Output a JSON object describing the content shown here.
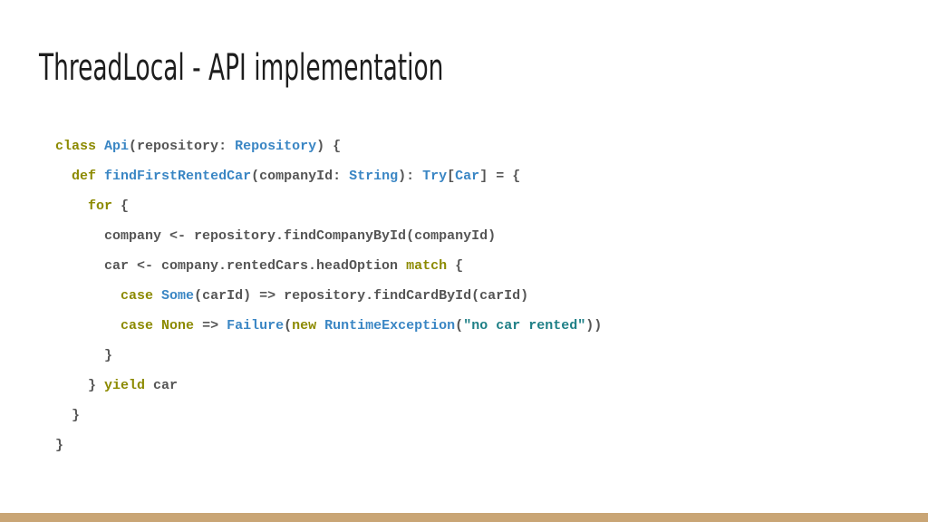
{
  "slide": {
    "title": "ThreadLocal - API implementation",
    "accent_bar_color": "#c9a575",
    "code_colors": {
      "keyword": "#8c8a00",
      "type": "#3a86c4",
      "string": "#1e7f86",
      "plain": "#555555"
    },
    "code_lines": [
      [
        {
          "t": "class",
          "k": "kw"
        },
        {
          "t": " ",
          "k": "pl"
        },
        {
          "t": "Api",
          "k": "tp"
        },
        {
          "t": "(repository: ",
          "k": "pl"
        },
        {
          "t": "Repository",
          "k": "tp"
        },
        {
          "t": ") {",
          "k": "pl"
        }
      ],
      [
        {
          "t": "  ",
          "k": "pl"
        },
        {
          "t": "def",
          "k": "kw"
        },
        {
          "t": " ",
          "k": "pl"
        },
        {
          "t": "findFirstRentedCar",
          "k": "tp"
        },
        {
          "t": "(companyId: ",
          "k": "pl"
        },
        {
          "t": "String",
          "k": "tp"
        },
        {
          "t": "): ",
          "k": "pl"
        },
        {
          "t": "Try",
          "k": "tp"
        },
        {
          "t": "[",
          "k": "pl"
        },
        {
          "t": "Car",
          "k": "tp"
        },
        {
          "t": "] = {",
          "k": "pl"
        }
      ],
      [
        {
          "t": "    ",
          "k": "pl"
        },
        {
          "t": "for",
          "k": "kw"
        },
        {
          "t": " {",
          "k": "pl"
        }
      ],
      [
        {
          "t": "      company <- repository.findCompanyById(companyId)",
          "k": "pl"
        }
      ],
      [
        {
          "t": "      car <- company.rentedCars.headOption ",
          "k": "pl"
        },
        {
          "t": "match",
          "k": "kw"
        },
        {
          "t": " {",
          "k": "pl"
        }
      ],
      [
        {
          "t": "        ",
          "k": "pl"
        },
        {
          "t": "case",
          "k": "kw"
        },
        {
          "t": " ",
          "k": "pl"
        },
        {
          "t": "Some",
          "k": "tp"
        },
        {
          "t": "(carId) => repository.findCardById(carId)",
          "k": "pl"
        }
      ],
      [
        {
          "t": "        ",
          "k": "pl"
        },
        {
          "t": "case",
          "k": "kw"
        },
        {
          "t": " ",
          "k": "pl"
        },
        {
          "t": "None",
          "k": "kw"
        },
        {
          "t": " => ",
          "k": "pl"
        },
        {
          "t": "Failure",
          "k": "tp"
        },
        {
          "t": "(",
          "k": "pl"
        },
        {
          "t": "new",
          "k": "kw"
        },
        {
          "t": " ",
          "k": "pl"
        },
        {
          "t": "RuntimeException",
          "k": "tp"
        },
        {
          "t": "(",
          "k": "pl"
        },
        {
          "t": "\"no car rented\"",
          "k": "str"
        },
        {
          "t": "))",
          "k": "pl"
        }
      ],
      [
        {
          "t": "      }",
          "k": "pl"
        }
      ],
      [
        {
          "t": "    } ",
          "k": "pl"
        },
        {
          "t": "yield",
          "k": "kw"
        },
        {
          "t": " car",
          "k": "pl"
        }
      ],
      [
        {
          "t": "  }",
          "k": "pl"
        }
      ],
      [
        {
          "t": "}",
          "k": "pl"
        }
      ]
    ]
  }
}
